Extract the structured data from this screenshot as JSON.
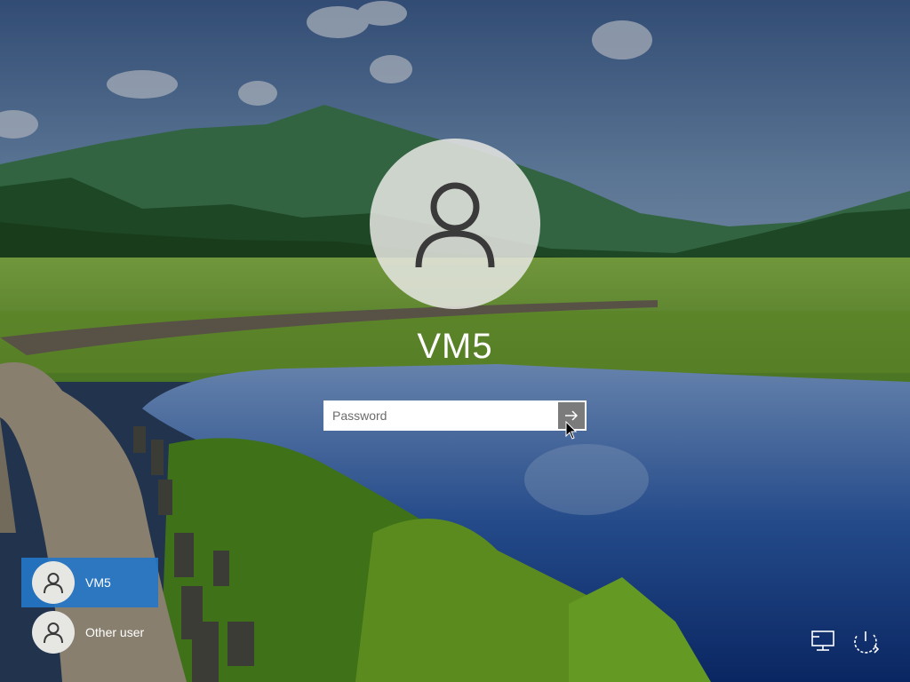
{
  "login": {
    "username": "VM5",
    "password_placeholder": "Password",
    "password_value": "",
    "submit_icon": "arrow-right-icon"
  },
  "user_list": [
    {
      "label": "VM5",
      "selected": true,
      "icon": "user-icon"
    },
    {
      "label": "Other user",
      "selected": false,
      "icon": "user-icon"
    }
  ],
  "system_icons": [
    {
      "name": "network-icon"
    },
    {
      "name": "power-icon"
    }
  ],
  "colors": {
    "selected_tile": "#2476c6",
    "submit_button": "#7b7b7b",
    "text": "#ffffff"
  }
}
